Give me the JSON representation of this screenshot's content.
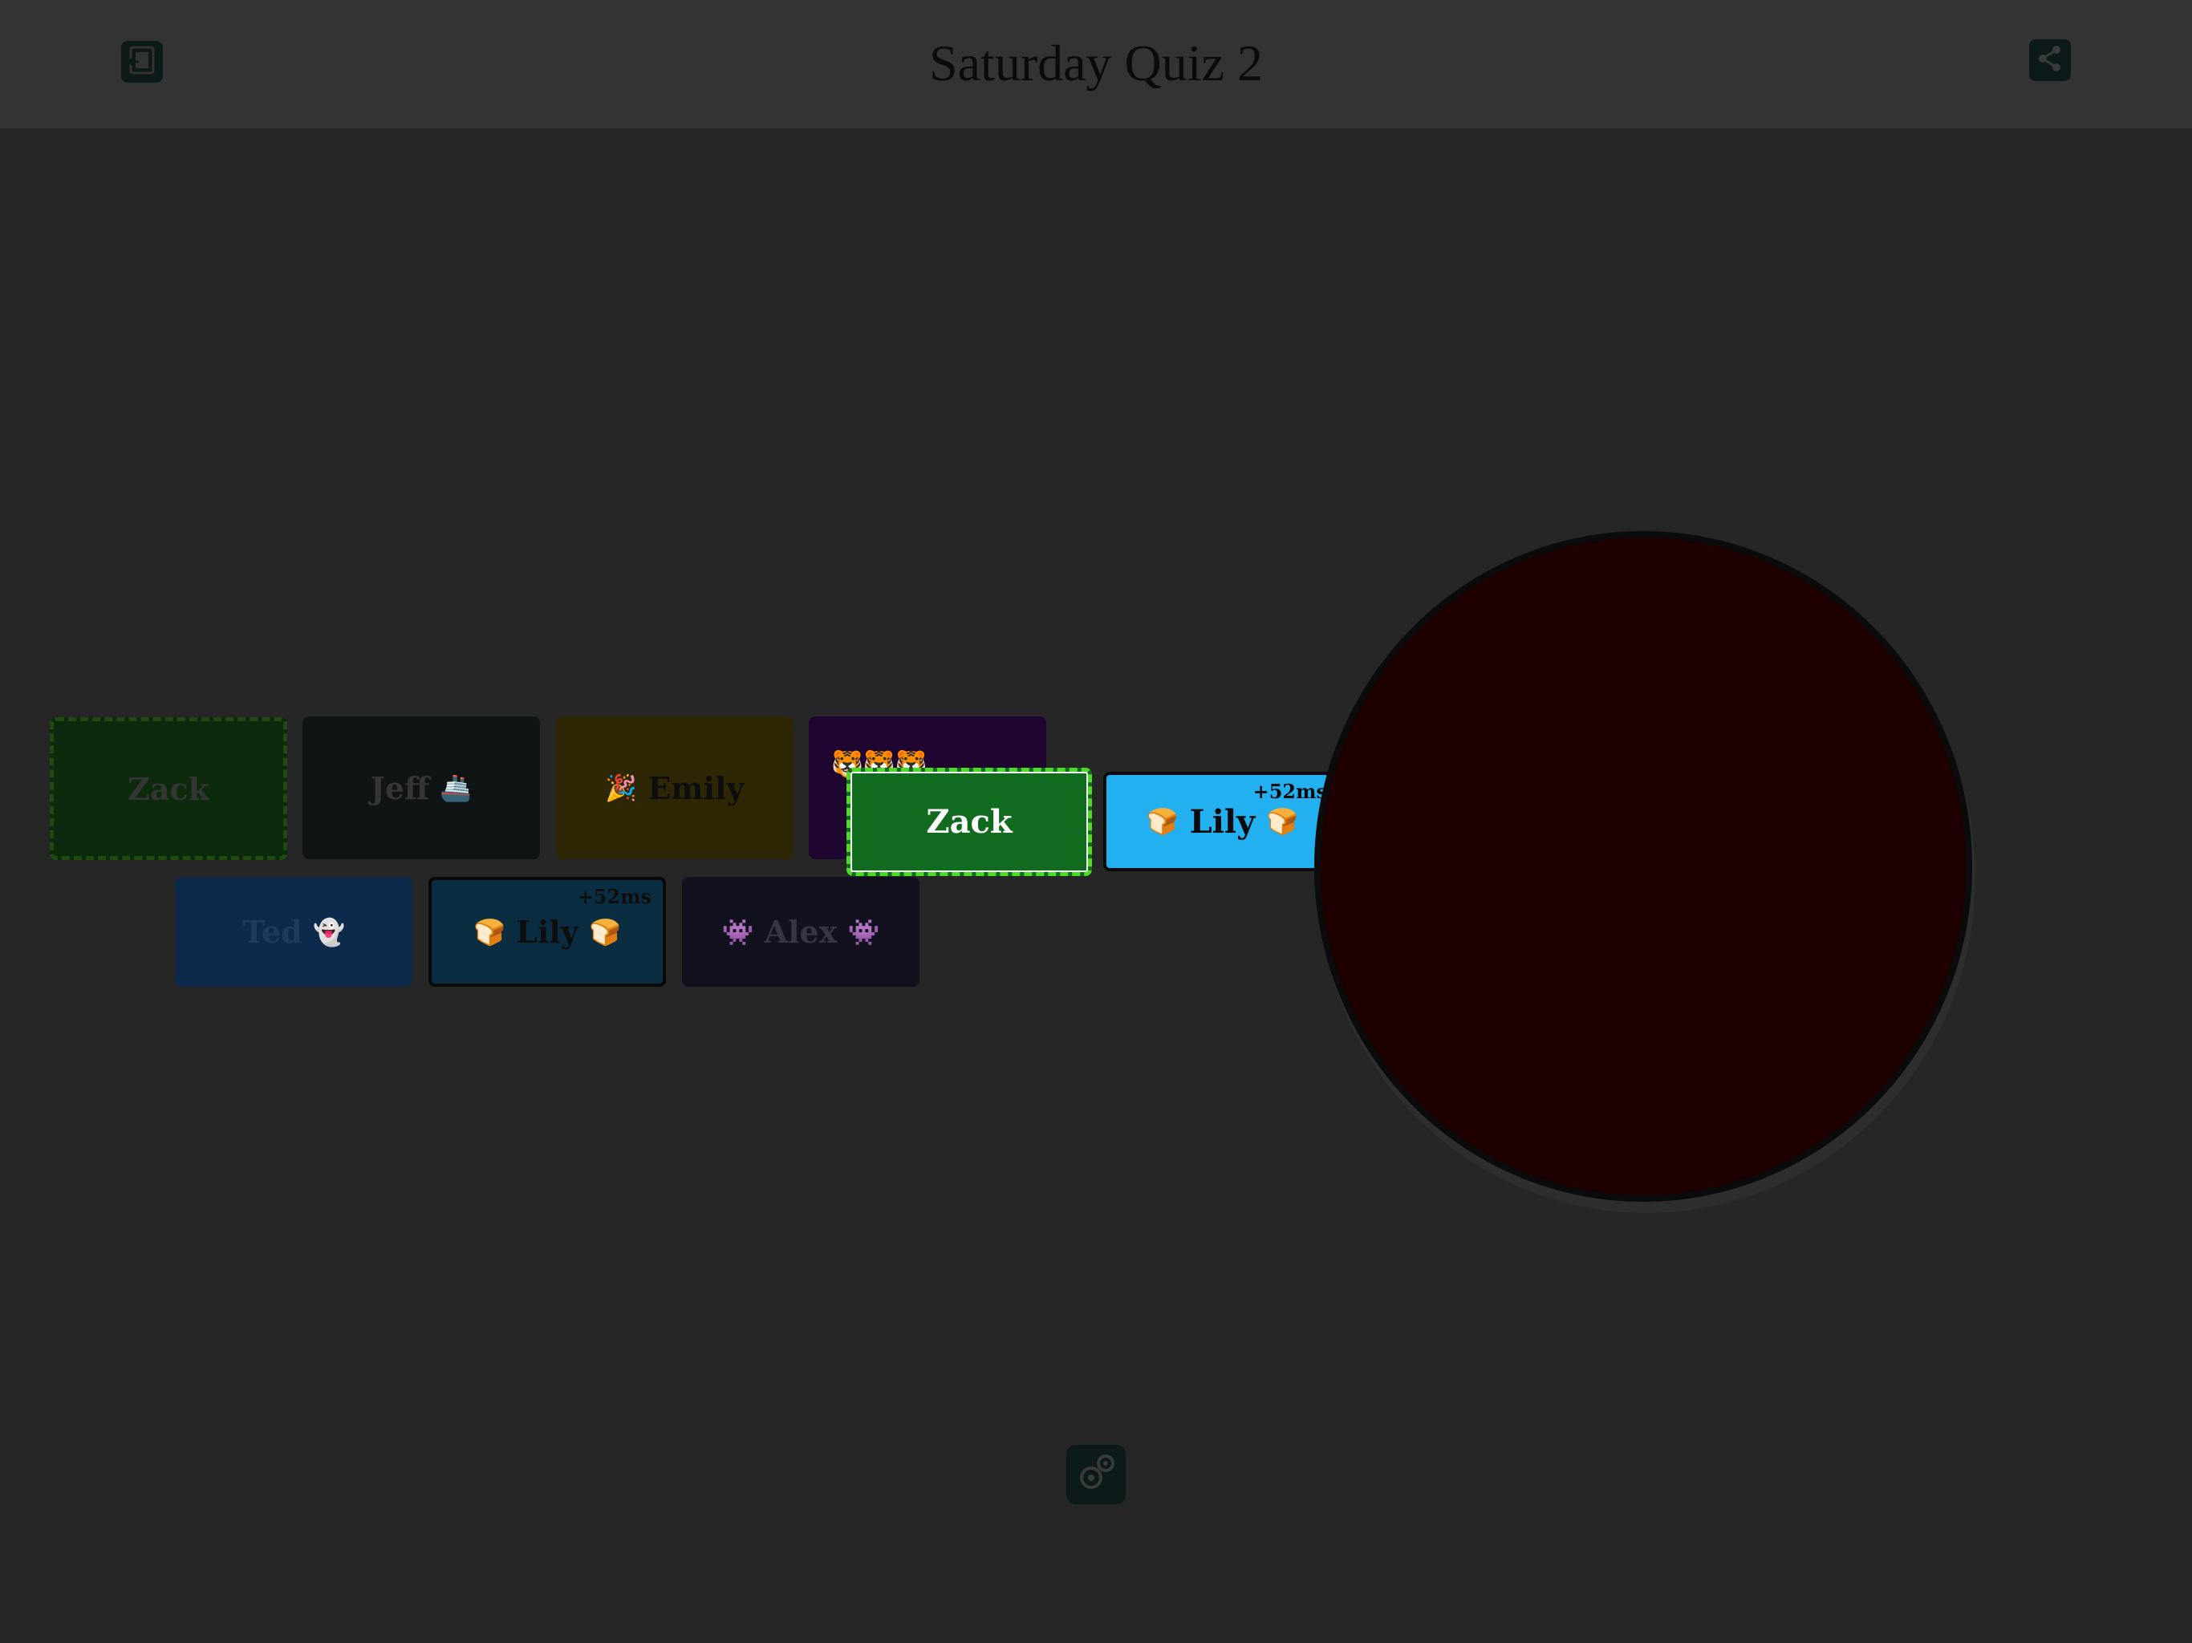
{
  "header": {
    "title": "Saturday Quiz 2",
    "exit_icon": "exit-icon",
    "share_icon": "share-icon"
  },
  "players": [
    {
      "name": "Zack",
      "color": "#0d2a0d",
      "state": "buzzed-first"
    },
    {
      "name": "Jeff",
      "emoji": "🚢",
      "color": "#0f1414"
    },
    {
      "name": "Emily",
      "emoji": "🎉",
      "color": "#2e2705"
    },
    {
      "name": "",
      "emoji": "🐯🐯🐯",
      "color": "#1e0630"
    },
    {
      "name": "Ted",
      "emoji": "👻",
      "color": "#0d2a4a"
    },
    {
      "name": "Lily",
      "emoji": "🍞",
      "color": "#0a2d42",
      "delay": "+52ms"
    },
    {
      "name": "Alex",
      "emoji": "👾",
      "color": "#12121e"
    }
  ],
  "highlight": {
    "first": {
      "name": "Zack",
      "color": "#106b1f",
      "border": "#4bdc25"
    },
    "second": {
      "name": "Lily",
      "emoji": "🍞",
      "color": "#22b0f0",
      "delay": "+52ms"
    }
  },
  "buzzer": {
    "color": "#1f0000"
  },
  "footer": {
    "settings_icon": "gears-icon"
  }
}
